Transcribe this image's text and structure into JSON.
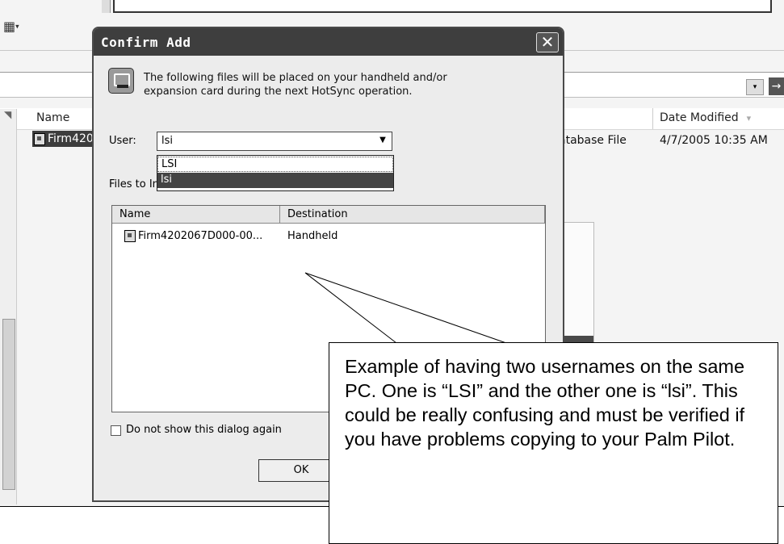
{
  "explorer": {
    "columns": {
      "name": "Name",
      "date_modified": "Date Modified"
    },
    "row": {
      "name": "Firm420",
      "type": "atabase File",
      "date": "4/7/2005 10:35 AM"
    },
    "view_caret": "▾",
    "addr_drop_glyph": "▾",
    "addr_go_glyph": "→"
  },
  "dialog": {
    "title": "Confirm Add",
    "close_glyph": "✕",
    "message": "The following files will be placed on your handheld and/or expansion card during the next HotSync operation.",
    "user_label": "User:",
    "user_value": "lsi",
    "user_drop_glyph": "▼",
    "user_options": [
      "LSI",
      "lsi"
    ],
    "files_label": "Files to Install:",
    "files_columns": {
      "name": "Name",
      "destination": "Destination"
    },
    "files": [
      {
        "name": "Firm4202067D000-00...",
        "destination": "Handheld"
      }
    ],
    "checkbox_label": "Do not show this dialog again",
    "ok_label": "OK"
  },
  "callout": {
    "text": "Example of having two usernames on the same PC. One is “LSI” and the other one is “lsi”. This could be really confusing and must be verified if you have problems copying to your Palm Pilot."
  }
}
